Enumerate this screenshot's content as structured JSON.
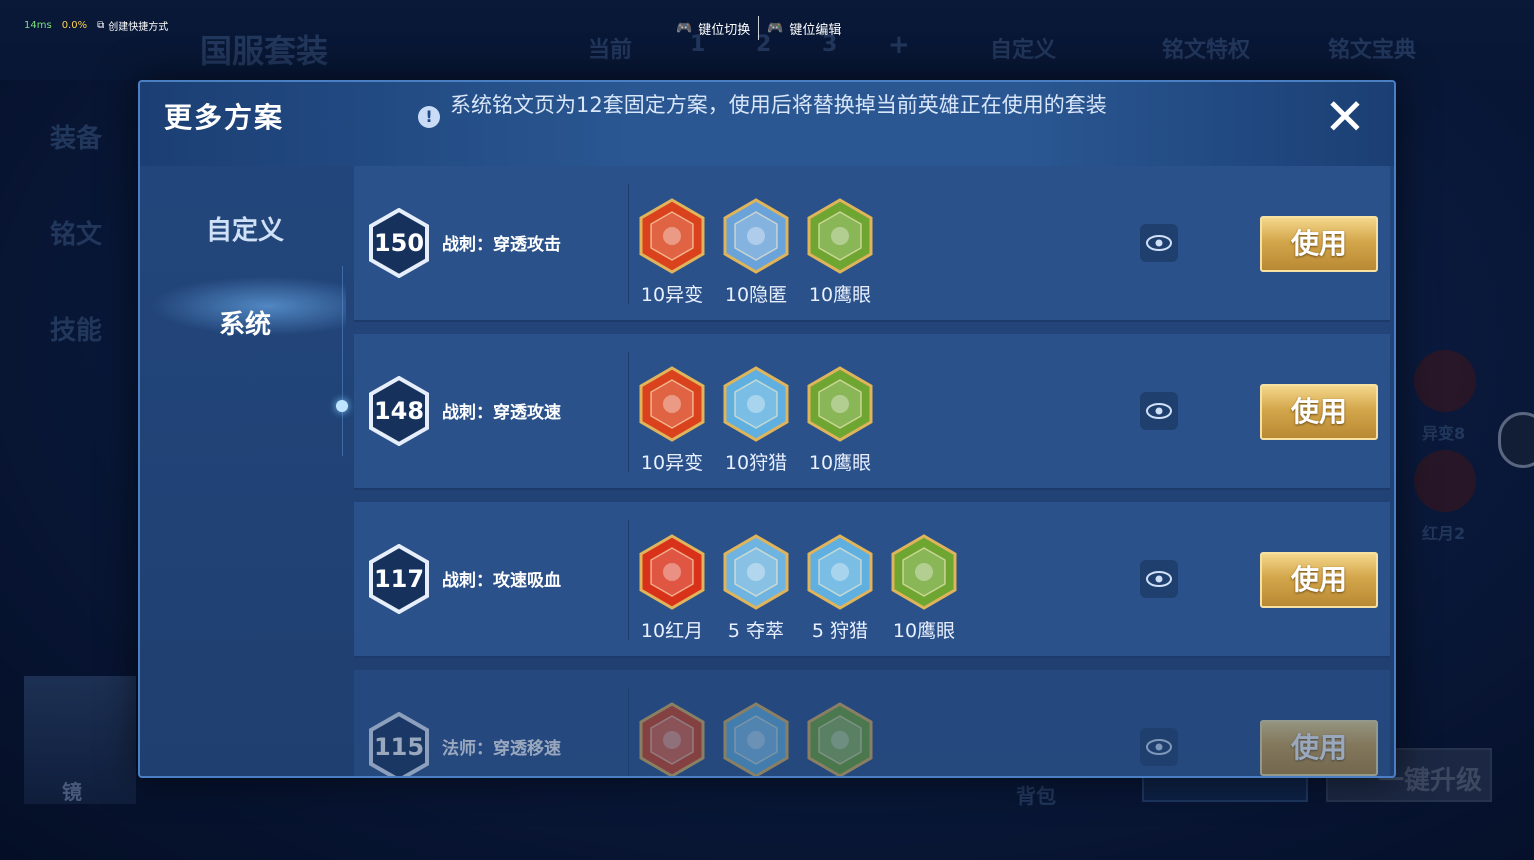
{
  "hud": {
    "latency": "14ms",
    "loss": "0.0%",
    "shortcut": "创建快捷方式",
    "key_switch": "键位切换",
    "key_edit": "键位编辑"
  },
  "background": {
    "title": "国服套装",
    "current": "当前",
    "page_nums": [
      "1",
      "2",
      "3"
    ],
    "plus": "+",
    "custom": "自定义",
    "privilege": "铭文特权",
    "codex": "铭文宝典",
    "side_items": [
      "装备",
      "铭文",
      "技能"
    ],
    "hero_name": "镜",
    "bag": "背包",
    "upgrade1": "一键升级",
    "upgrade2": "一键升级",
    "rune_side": [
      {
        "label": "异变8"
      },
      {
        "label": "红月2"
      }
    ]
  },
  "modal": {
    "title": "更多方案",
    "notice": "系统铭文页为12套固定方案，使用后将替换掉当前英雄正在使用的套装",
    "close_label": "✕",
    "nav": [
      {
        "label": "自定义",
        "active": false
      },
      {
        "label": "系统",
        "active": true
      }
    ],
    "use_label": "使用",
    "rows": [
      {
        "level": "150",
        "name": "战刺：穿透攻击",
        "runes": [
          {
            "icon": "rune-yibian-red-icon",
            "label": "10异变",
            "color": "#d9421c"
          },
          {
            "icon": "rune-yinni-blue-icon",
            "label": "10隐匿",
            "color": "#6aa3d9"
          },
          {
            "icon": "rune-yingyan-green-icon",
            "label": "10鹰眼",
            "color": "#6fa632"
          }
        ]
      },
      {
        "level": "148",
        "name": "战刺：穿透攻速",
        "runes": [
          {
            "icon": "rune-yibian-red-icon",
            "label": "10异变",
            "color": "#d9421c"
          },
          {
            "icon": "rune-shoulie-blue-icon",
            "label": "10狩猎",
            "color": "#5fb0e0"
          },
          {
            "icon": "rune-yingyan-green-icon",
            "label": "10鹰眼",
            "color": "#6fa632"
          }
        ]
      },
      {
        "level": "117",
        "name": "战刺：攻速吸血",
        "runes": [
          {
            "icon": "rune-hongyue-red-icon",
            "label": "10红月",
            "color": "#d8321a"
          },
          {
            "icon": "rune-duocui-blue-icon",
            "label": "5 夺萃",
            "color": "#6fb4e0"
          },
          {
            "icon": "rune-shoulie-blue-icon",
            "label": "5 狩猎",
            "color": "#5fb0e0"
          },
          {
            "icon": "rune-yingyan-green-icon",
            "label": "10鹰眼",
            "color": "#6fa632"
          }
        ]
      },
      {
        "level": "115",
        "name": "法师：穿透移速",
        "runes": [
          {
            "icon": "rune-red-icon",
            "label": "",
            "color": "#d9421c"
          },
          {
            "icon": "rune-blue-icon",
            "label": "",
            "color": "#5fb0e0"
          },
          {
            "icon": "rune-green-icon",
            "label": "",
            "color": "#6fa632"
          }
        ]
      }
    ]
  }
}
